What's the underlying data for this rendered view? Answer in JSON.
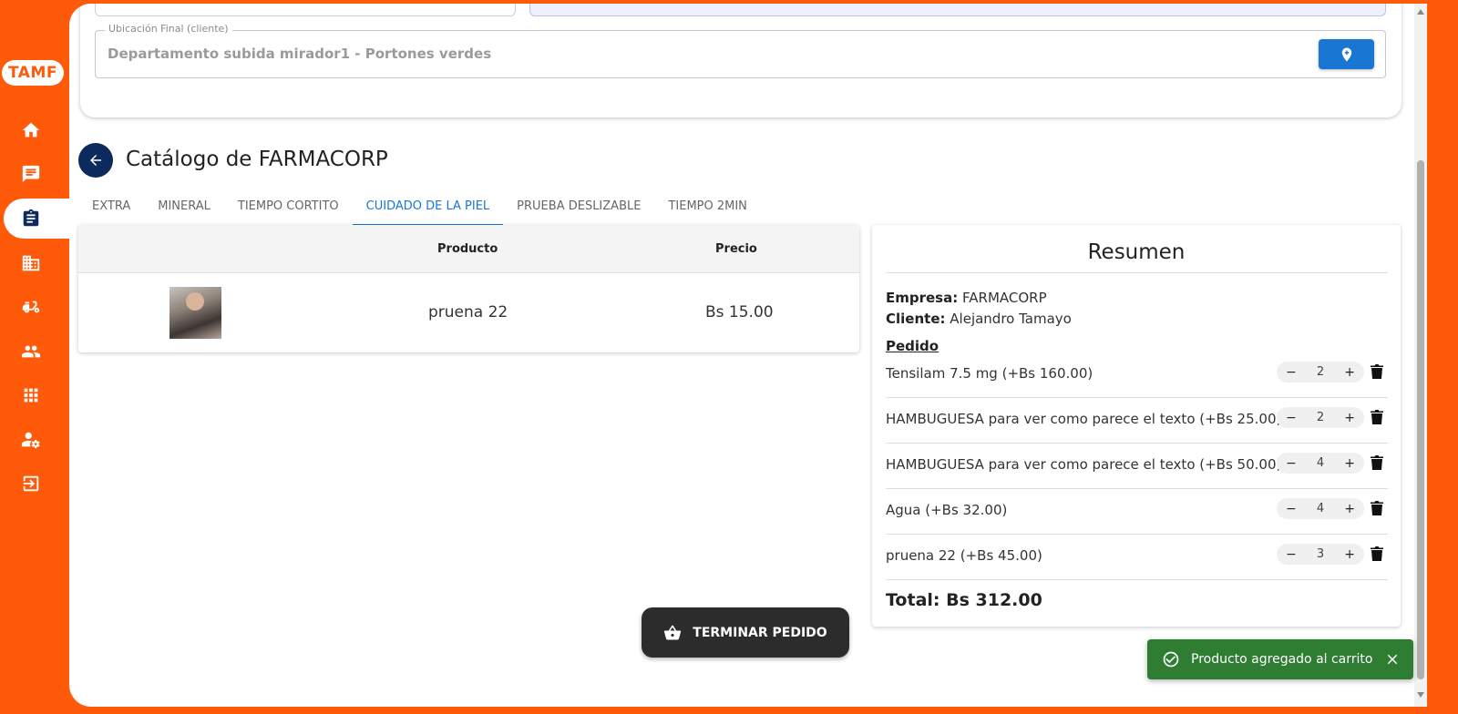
{
  "app": {
    "logo": "TAMF"
  },
  "sidebar": {
    "items": [
      {
        "icon": "home-icon"
      },
      {
        "icon": "chat-icon"
      },
      {
        "icon": "clipboard-icon",
        "active": true
      },
      {
        "icon": "building-icon"
      },
      {
        "icon": "moped-icon"
      },
      {
        "icon": "group-icon"
      },
      {
        "icon": "apps-grid-icon"
      },
      {
        "icon": "user-settings-icon"
      },
      {
        "icon": "logout-icon"
      }
    ]
  },
  "location": {
    "label": "Ubicación Final (cliente)",
    "value": "Departamento subida mirador1 - Portones verdes",
    "button_icon": "location-pin-icon"
  },
  "catalog": {
    "title": "Catálogo de FARMACORP",
    "tabs": [
      {
        "label": "EXTRA",
        "active": false
      },
      {
        "label": "MINERAL",
        "active": false
      },
      {
        "label": "TIEMPO CORTITO",
        "active": false
      },
      {
        "label": "CUIDADO DE LA PIEL",
        "active": true
      },
      {
        "label": "PRUEBA DESLIZABLE",
        "active": false
      },
      {
        "label": "TIEMPO 2MIN",
        "active": false
      }
    ],
    "table": {
      "headers": {
        "producto": "Producto",
        "precio": "Precio"
      },
      "rows": [
        {
          "name": "pruena 22",
          "price": "Bs 15.00"
        }
      ]
    }
  },
  "resumen": {
    "title": "Resumen",
    "empresa_label": "Empresa:",
    "empresa": "FARMACORP",
    "cliente_label": "Cliente:",
    "cliente": "Alejandro Tamayo",
    "pedido_label": "Pedido",
    "items": [
      {
        "name": "Tensilam 7.5 mg (+Bs 160.00)",
        "qty": "2"
      },
      {
        "name": "HAMBUGUESA para ver como parece el texto (+Bs 25.00)",
        "qty": "2"
      },
      {
        "name": "HAMBUGUESA para ver como parece el texto (+Bs 50.00)",
        "qty": "4"
      },
      {
        "name": "Agua (+Bs 32.00)",
        "qty": "4"
      },
      {
        "name": "pruena 22 (+Bs 45.00)",
        "qty": "3"
      }
    ],
    "minus": "−",
    "plus": "+",
    "total": "Total: Bs 312.00"
  },
  "actions": {
    "terminar": "TERMINAR PEDIDO"
  },
  "toast": {
    "message": "Producto agregado al carrito"
  },
  "colors": {
    "brand": "#ff5a0a",
    "navy": "#0d2a5c",
    "primary": "#1976d2",
    "success": "#2e7d32"
  }
}
